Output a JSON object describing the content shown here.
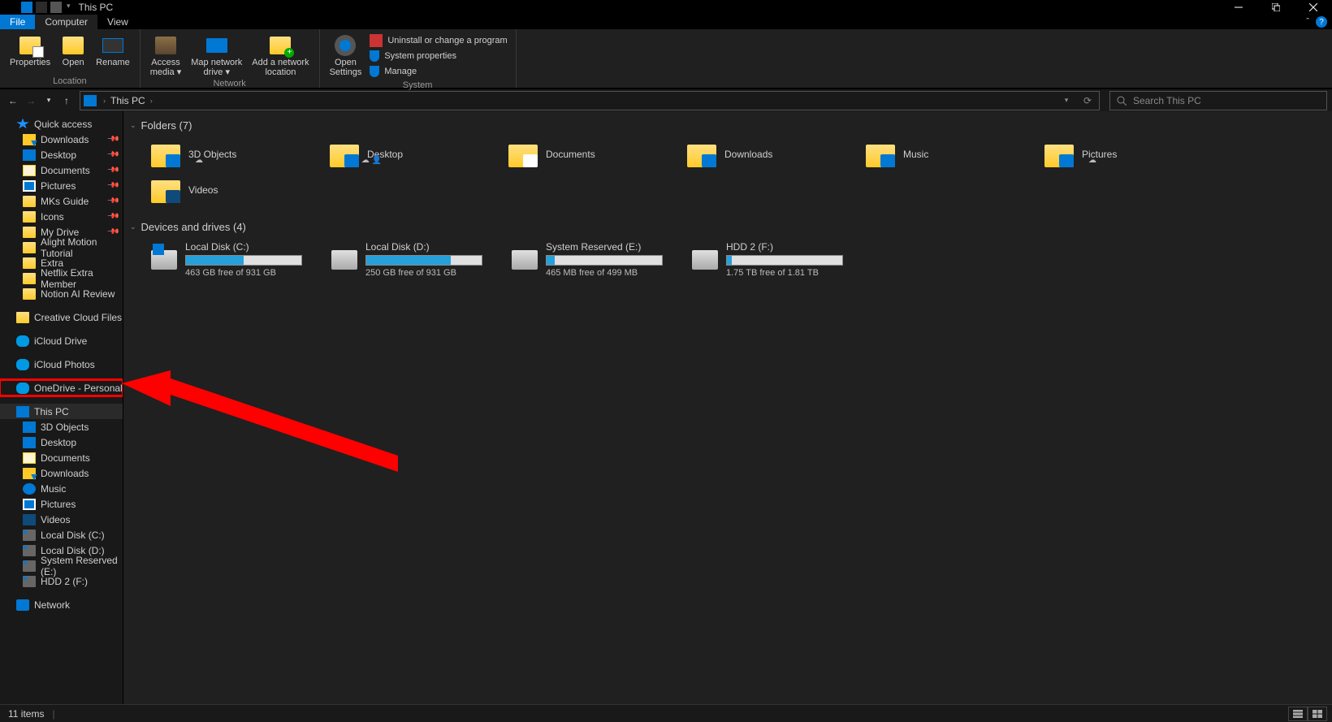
{
  "window": {
    "title": "This PC"
  },
  "tabs": {
    "file": "File",
    "computer": "Computer",
    "view": "View"
  },
  "ribbon": {
    "location": {
      "label": "Location",
      "properties": "Properties",
      "open": "Open",
      "rename": "Rename"
    },
    "network": {
      "label": "Network",
      "access": "Access\nmedia ▾",
      "map_drive": "Map network\ndrive ▾",
      "add_location": "Add a network\nlocation"
    },
    "system": {
      "label": "System",
      "open_settings": "Open\nSettings",
      "uninstall": "Uninstall or change a program",
      "sys_props": "System properties",
      "manage": "Manage"
    }
  },
  "address": {
    "crumb": "This PC",
    "search_placeholder": "Search This PC"
  },
  "sidebar": {
    "quick_access": "Quick access",
    "quick_items": [
      {
        "label": "Downloads",
        "pinned": true,
        "icon": "ic-down"
      },
      {
        "label": "Desktop",
        "pinned": true,
        "icon": "ic-desktop"
      },
      {
        "label": "Documents",
        "pinned": true,
        "icon": "ic-doc"
      },
      {
        "label": "Pictures",
        "pinned": true,
        "icon": "ic-pic"
      },
      {
        "label": "MKs Guide",
        "pinned": true,
        "icon": "ic-fold"
      },
      {
        "label": "Icons",
        "pinned": true,
        "icon": "ic-fold"
      },
      {
        "label": "My Drive",
        "pinned": true,
        "icon": "ic-fold"
      },
      {
        "label": "Alight Motion Tutorial",
        "pinned": false,
        "icon": "ic-fold"
      },
      {
        "label": "Extra",
        "pinned": false,
        "icon": "ic-fold"
      },
      {
        "label": "Netflix Extra Member",
        "pinned": false,
        "icon": "ic-fold"
      },
      {
        "label": "Notion AI Review",
        "pinned": false,
        "icon": "ic-fold"
      }
    ],
    "creative_cloud": "Creative Cloud Files",
    "icloud_drive": "iCloud Drive",
    "icloud_photos": "iCloud Photos",
    "onedrive": "OneDrive - Personal",
    "this_pc": "This PC",
    "pc_items": [
      {
        "label": "3D Objects",
        "icon": "ic-3d"
      },
      {
        "label": "Desktop",
        "icon": "ic-desktop"
      },
      {
        "label": "Documents",
        "icon": "ic-doc"
      },
      {
        "label": "Downloads",
        "icon": "ic-down"
      },
      {
        "label": "Music",
        "icon": "ic-music"
      },
      {
        "label": "Pictures",
        "icon": "ic-pic"
      },
      {
        "label": "Videos",
        "icon": "ic-video"
      },
      {
        "label": "Local Disk (C:)",
        "icon": "ic-hdd"
      },
      {
        "label": "Local Disk (D:)",
        "icon": "ic-hdd"
      },
      {
        "label": "System Reserved (E:)",
        "icon": "ic-hdd"
      },
      {
        "label": "HDD 2 (F:)",
        "icon": "ic-hdd"
      }
    ],
    "network": "Network"
  },
  "content": {
    "folders_header": "Folders (7)",
    "folders": [
      {
        "label": "3D Objects",
        "badge": "#0078d4",
        "cloud": "☁"
      },
      {
        "label": "Desktop",
        "badge": "#0078d4",
        "cloud": "☁ 👤"
      },
      {
        "label": "Documents",
        "badge": "#fff",
        "cloud": ""
      },
      {
        "label": "Downloads",
        "badge": "#0078d4",
        "cloud": ""
      },
      {
        "label": "Music",
        "badge": "#0078d4",
        "cloud": ""
      },
      {
        "label": "Pictures",
        "badge": "#0078d4",
        "cloud": "☁"
      },
      {
        "label": "Videos",
        "badge": "#0e4a7a",
        "cloud": ""
      }
    ],
    "drives_header": "Devices and drives (4)",
    "drives": [
      {
        "name": "Local Disk (C:)",
        "free": "463 GB free of 931 GB",
        "pct": 50,
        "win": true
      },
      {
        "name": "Local Disk (D:)",
        "free": "250 GB free of 931 GB",
        "pct": 73,
        "win": false
      },
      {
        "name": "System Reserved (E:)",
        "free": "465 MB free of 499 MB",
        "pct": 7,
        "win": false
      },
      {
        "name": "HDD 2 (F:)",
        "free": "1.75 TB free of 1.81 TB",
        "pct": 4,
        "win": false
      }
    ]
  },
  "statusbar": {
    "items": "11 items"
  },
  "annotation": {
    "highlighted_item": "OneDrive - Personal"
  }
}
